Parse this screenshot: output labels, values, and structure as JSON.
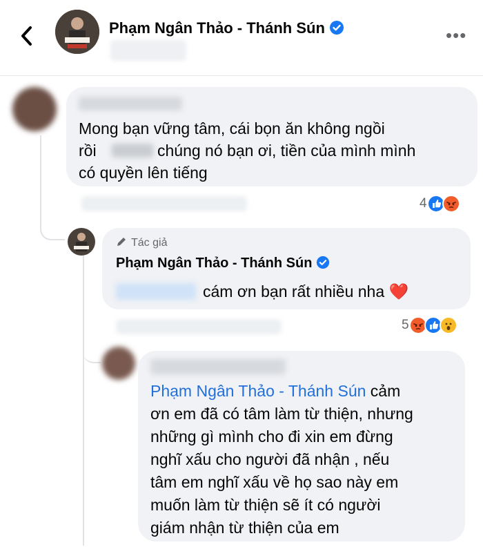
{
  "header": {
    "page_name": "Phạm Ngân Thảo - Thánh Sún",
    "more_label": "•••"
  },
  "comments": [
    {
      "lines": [
        "Mong bạn vững tâm, cái bọn ăn không ngồi",
        "rồi",
        "chúng nó bạn ơi, tiền của mình mình",
        "có quyền lên tiếng"
      ],
      "reaction_count": "4",
      "reactions": [
        "like-icon",
        "angry-icon"
      ]
    },
    {
      "badge": "Tác giả",
      "author": "Phạm Ngân Thảo - Thánh Sún",
      "text": "cám ơn bạn rất nhiều nha",
      "emoji": "❤️",
      "reaction_count": "5",
      "reactions": [
        "angry-icon",
        "like-icon",
        "wow-icon"
      ]
    },
    {
      "mention": "Phạm Ngân Thảo - Thánh Sún",
      "lines": [
        " cảm",
        "ơn em đã có tâm làm từ thiện, nhưng",
        "những gì mình cho đi xin em đừng",
        "nghĩ xấu cho người đã nhận , nếu",
        "tâm em nghĩ xấu về họ sao này em",
        "muốn làm từ thiện sẽ ít có người",
        "giám nhận từ thiện của em"
      ]
    }
  ],
  "colors": {
    "bubble": "#f0f2f5",
    "link": "#216fdb",
    "like": "#1877f2",
    "angry": "#f25c2b",
    "verified": "#1877f2"
  }
}
